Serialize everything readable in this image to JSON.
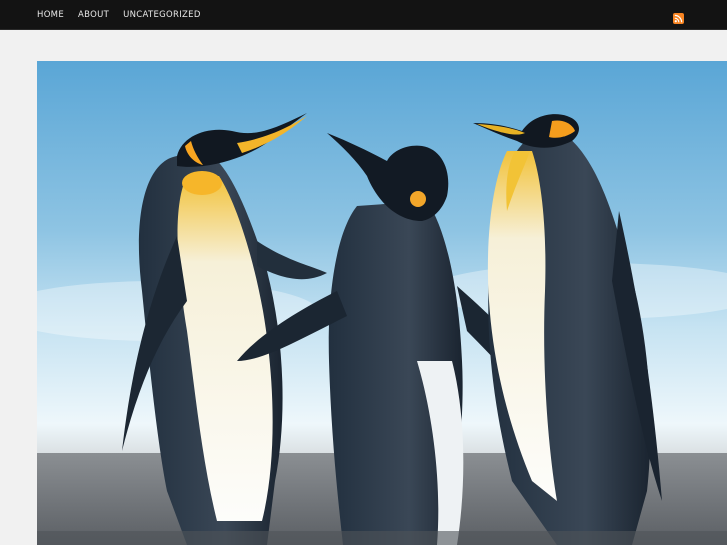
{
  "nav": {
    "items": [
      {
        "label": "HOME"
      },
      {
        "label": "ABOUT"
      },
      {
        "label": "UNCATEGORIZED"
      }
    ]
  },
  "rss": {
    "icon": "rss-icon",
    "color": "#f78422"
  },
  "featured_image": {
    "icon": "penguins-photo"
  }
}
